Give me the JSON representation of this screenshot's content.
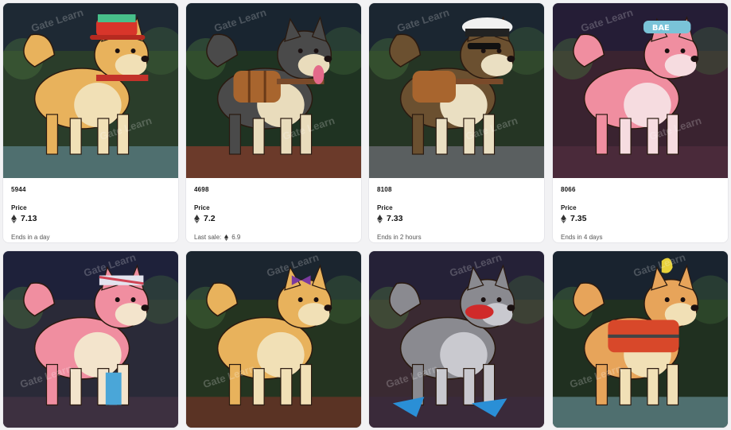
{
  "watermark": "Gate Learn",
  "cards": [
    {
      "id": "5944",
      "price_label": "Price",
      "price": "7.13",
      "footer_prefix": "Ends in a day",
      "footer_value": "",
      "bg": "#2a3d2a",
      "fur": "#e8b25c",
      "belly": "#f1e0b6",
      "accessory": "red-cap",
      "floor": "#4f6f6f"
    },
    {
      "id": "4698",
      "price_label": "Price",
      "price": "7.2",
      "footer_prefix": "Last sale:",
      "footer_value": "6.9",
      "bg": "#1f3322",
      "fur": "#4a4a4a",
      "belly": "#e9dcbc",
      "accessory": "barrels",
      "floor": "#6b3a2a"
    },
    {
      "id": "8108",
      "price_label": "Price",
      "price": "7.33",
      "footer_prefix": "Ends in 2 hours",
      "footer_value": "",
      "bg": "#253524",
      "fur": "#6b5030",
      "belly": "#eadfc2",
      "accessory": "captain-hat",
      "floor": "#5a5f60"
    },
    {
      "id": "8066",
      "price_label": "Price",
      "price": "7.35",
      "footer_prefix": "Ends in 4 days",
      "footer_value": "",
      "bg": "#3a2330",
      "fur": "#f08ea0",
      "belly": "#f6dce0",
      "accessory": "headband",
      "floor": "#4a2a3a"
    }
  ],
  "bottom_cards": [
    {
      "bg": "#2a2a38",
      "fur": "#f08ea0",
      "belly": "#f3e4cc",
      "accessory": "bandana",
      "floor": "#3d3040"
    },
    {
      "bg": "#243420",
      "fur": "#e8b25c",
      "belly": "#f1e0b6",
      "accessory": "bow",
      "floor": "#5a3324"
    },
    {
      "bg": "#3a2a32",
      "fur": "#8a8a90",
      "belly": "#c9c9cf",
      "accessory": "flippers",
      "floor": "#3a2a3a"
    },
    {
      "bg": "#203020",
      "fur": "#e7a45a",
      "belly": "#f1e0b6",
      "accessory": "life-vest",
      "floor": "#4f6f6f"
    }
  ]
}
